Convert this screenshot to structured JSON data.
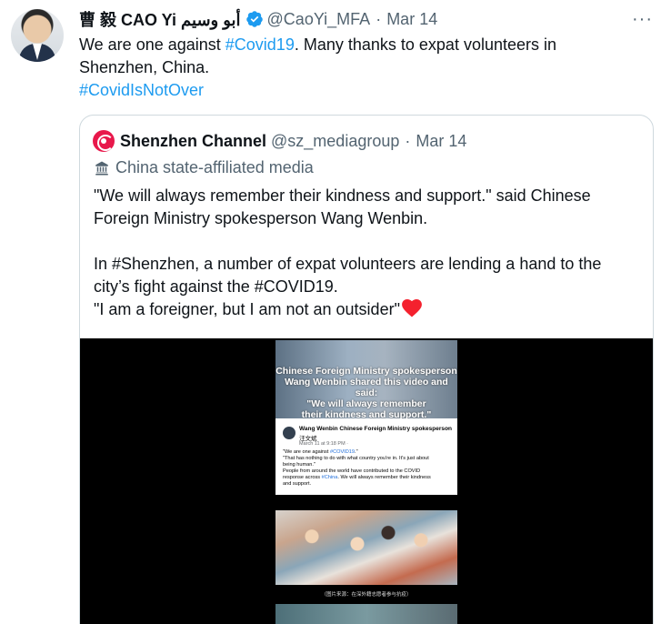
{
  "tweet": {
    "author_name": "曹 毅 CAO Yi أبو وسيم",
    "handle": "@CaoYi_MFA",
    "separator": "·",
    "date": "Mar 14",
    "more_label": "···",
    "text_line1_pre": "We are one against ",
    "text_line1_hashtag": "#Covid19",
    "text_line1_post": ". Many thanks to expat volunteers in",
    "text_line2": "Shenzhen, China.",
    "text_hashtag2": "#CovidIsNotOver"
  },
  "quoted": {
    "author_name": "Shenzhen Channel",
    "handle": "@sz_mediagroup",
    "separator": "·",
    "date": "Mar 14",
    "affiliation": "China state-affiliated media",
    "line1": "\"We will always remember their kindness and support.\" said Chinese",
    "line2": "Foreign Ministry spokesperson Wang Wenbin.",
    "line3": "In #Shenzhen, a number of expat volunteers are lending a hand to the",
    "line4": "city’s fight against the #COVID19.",
    "line5": "\"I am a foreigner, but I am not an outsider\""
  },
  "video": {
    "banner_line1": "Chinese Foreign Ministry spokesperson",
    "banner_line2": "Wang Wenbin shared this video and said:",
    "banner_line3": "\"We will always remember",
    "banner_line4": "their kindness and support.\"",
    "fb_name": "Wang Wenbin Chinese Foreign Ministry spokesperson",
    "fb_name2": "汪文斌",
    "fb_meta": "March 11 at 9:18 PM ·",
    "fb_dots": "···",
    "fb_text1_pre": "\"We are one against ",
    "fb_text1_link": "#COVID19",
    "fb_text1_post": ".\"",
    "fb_text2": "\"That has nothing to do with what country you're in. It's just about",
    "fb_text3": "being human.\"",
    "fb_text4": "People from around the world have contributed to the COVID",
    "fb_text5_pre": "response across ",
    "fb_text5_link": "#China",
    "fb_text5_post": ". We will always remember their kindness",
    "fb_text6": "and support.",
    "caption": "（图片来源：在深外籍志愿者参与抗疫）"
  },
  "colors": {
    "link": "#1d9bf0",
    "verified": "#1d9bf0",
    "heart": "#f4212e",
    "secondary_text": "#536471"
  },
  "icons": [
    "verified-badge-icon",
    "more-icon",
    "shenzhen-channel-logo",
    "state-media-icon",
    "heart-icon"
  ]
}
